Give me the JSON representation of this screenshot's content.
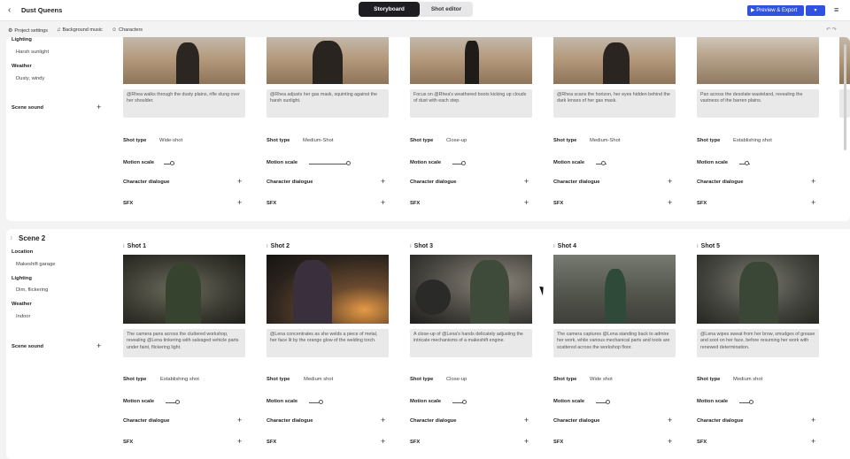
{
  "header": {
    "back_icon": "chevron-left-icon",
    "project_title": "Dust Queens",
    "tabs": [
      "Storyboard",
      "Shot editor"
    ],
    "preview_label": "▶ Preview & Export",
    "share_label": "▾",
    "menu_icon": "hamburger-icon",
    "accent_color": "#2f52e0"
  },
  "toolbar": {
    "project_settings": "Project settings",
    "background_music": "Background music",
    "characters": "Characters"
  },
  "labels": {
    "location": "Location",
    "lighting": "Lighting",
    "weather": "Weather",
    "scene_sound": "Scene sound",
    "shot_type": "Shot type",
    "motion_scale": "Motion scale",
    "character_dialogue": "Character dialogue",
    "sfx": "SFX"
  },
  "scene1": {
    "lighting_value": "Harsh sunlight",
    "weather_value": "Dusty, windy",
    "shots": [
      {
        "caption": "@Rhea walks through the dusty plains, rifle slung over her shoulder.",
        "shot_type": "Wide-shot",
        "motion": 0.5
      },
      {
        "caption": "@Rhea adjusts her gas mask, squinting against the harsh sunlight.",
        "shot_type": "Medium-Shot",
        "motion": 0.9
      },
      {
        "caption": "Focus on @Rhea's weathered boots kicking up clouds of dust with each step.",
        "shot_type": "Close-up",
        "motion": 0.6
      },
      {
        "caption": "@Rhea scans the horizon, her eyes hidden behind the dark lenses of her gas mask.",
        "shot_type": "Medium-Shot",
        "motion": 0.55
      },
      {
        "caption": "Pan across the desolate wasteland, revealing the vastness of the barren plains.",
        "shot_type": "Establishing shot",
        "motion": 0.55
      }
    ]
  },
  "scene2": {
    "title": "Scene 2",
    "location_value": "Makeshift garage",
    "lighting_value": "Dim, flickering",
    "weather_value": "Indoor",
    "shots": [
      {
        "name": "Shot 1",
        "caption": "The camera pans across the cluttered workshop, revealing @Lena tinkering with salvaged vehicle parts under faint, flickering light.",
        "shot_type": "Establishing shot",
        "motion": 0.5
      },
      {
        "name": "Shot 2",
        "caption": "@Lena concentrates as she welds a piece of metal, her face lit by the orange glow of the welding torch.",
        "shot_type": "Medium shot",
        "motion": 0.5
      },
      {
        "name": "Shot 3",
        "caption": "A close-up of @Lena's hands delicately adjusting the intricate mechanisms of a makeshift engine.",
        "shot_type": "Close-up",
        "motion": 0.5
      },
      {
        "name": "Shot 4",
        "caption": "The camera captures @Lena standing back to admire her work, while various mechanical parts and tools are scattered across the workshop floor.",
        "shot_type": "Wide shot",
        "motion": 0.5
      },
      {
        "name": "Shot 5",
        "caption": "@Lena wipes sweat from her brow, smudges of grease and soot on her face, before resuming her work with renewed determination.",
        "shot_type": "Medium shot",
        "motion": 0.5
      }
    ]
  }
}
